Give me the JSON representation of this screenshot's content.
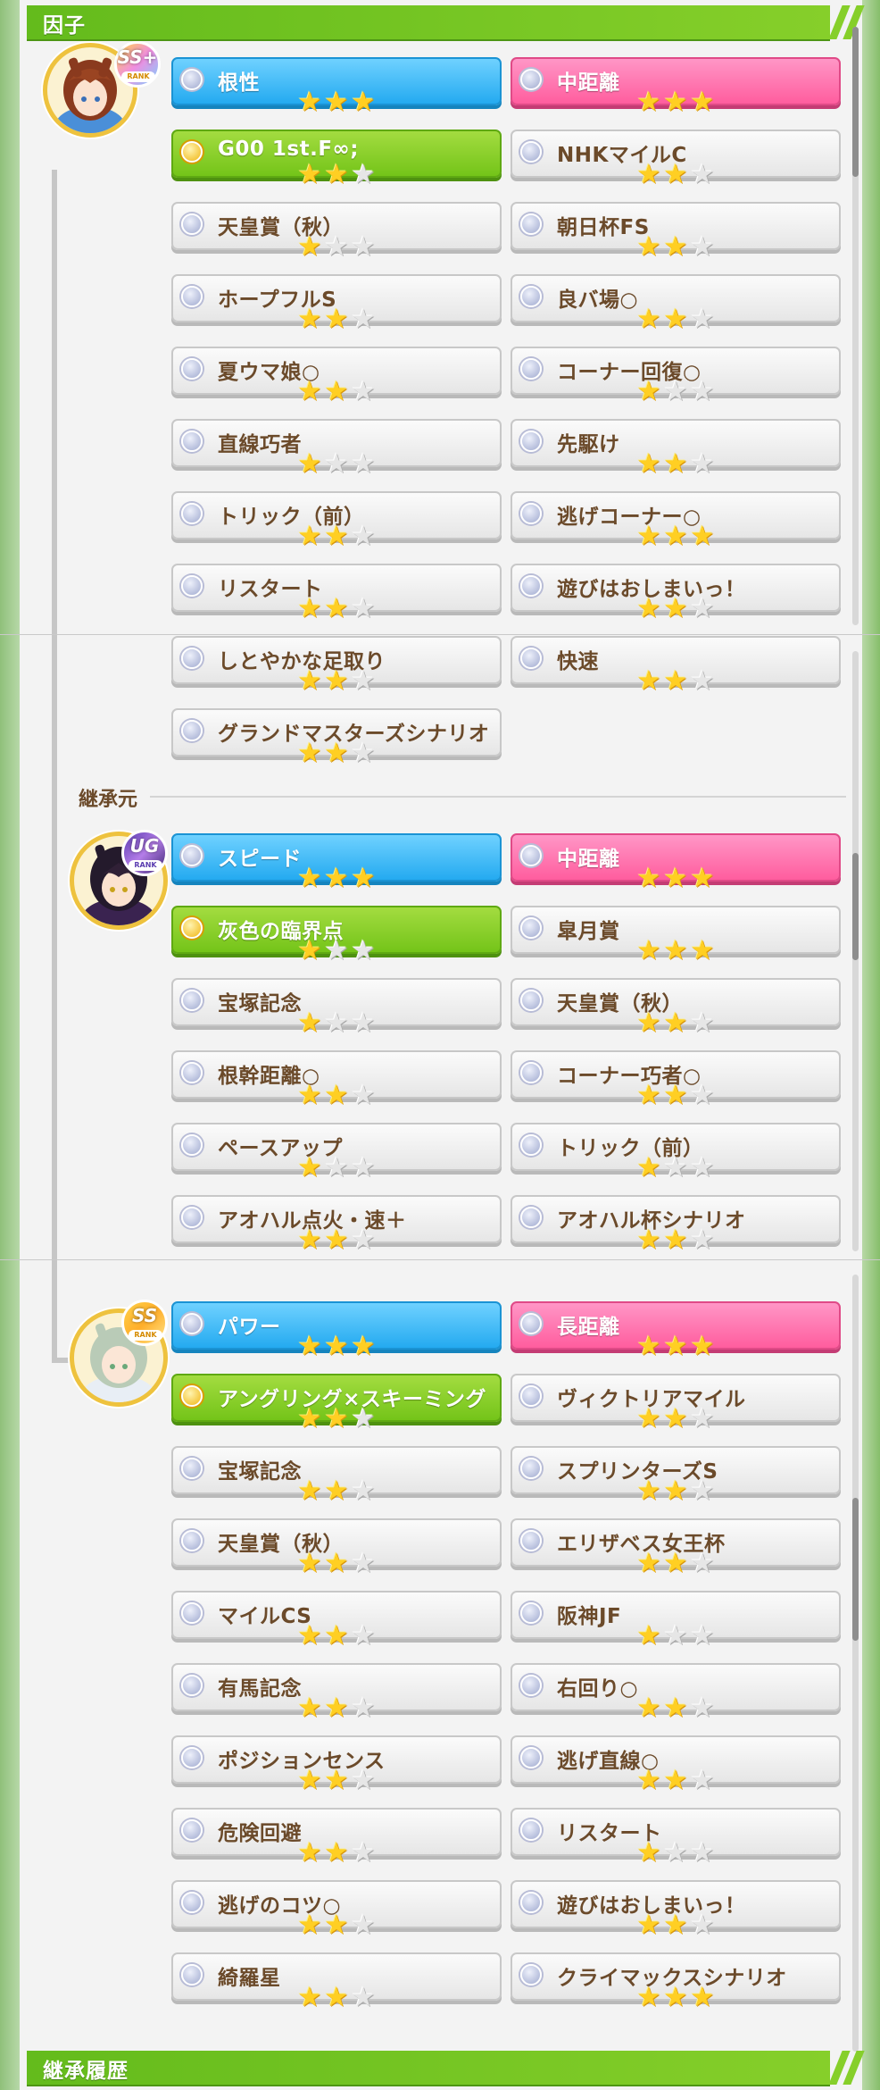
{
  "header": {
    "title": "因子"
  },
  "footer": {
    "title": "継承履歴"
  },
  "parents_label": "継承元",
  "colors": {
    "accent_green": "#74c419",
    "blue": "#24aaf0",
    "pink": "#ff5d9e",
    "text_brown": "#6b4a2a",
    "star_gold": "#ffcf23"
  },
  "trainee": {
    "rank": "SS+",
    "factors": [
      {
        "name": "根性",
        "stars": 3,
        "type": "blue"
      },
      {
        "name": "中距離",
        "stars": 3,
        "type": "pink"
      },
      {
        "name": "G00 1st.F∞;",
        "stars": 2,
        "type": "green"
      },
      {
        "name": "NHKマイルC",
        "stars": 2,
        "type": "white"
      },
      {
        "name": "天皇賞（秋）",
        "stars": 1,
        "type": "white"
      },
      {
        "name": "朝日杯FS",
        "stars": 2,
        "type": "white"
      },
      {
        "name": "ホープフルS",
        "stars": 2,
        "type": "white"
      },
      {
        "name": "良バ場○",
        "stars": 2,
        "type": "white"
      },
      {
        "name": "夏ウマ娘○",
        "stars": 2,
        "type": "white"
      },
      {
        "name": "コーナー回復○",
        "stars": 1,
        "type": "white"
      },
      {
        "name": "直線巧者",
        "stars": 1,
        "type": "white"
      },
      {
        "name": "先駆け",
        "stars": 2,
        "type": "white"
      },
      {
        "name": "トリック（前）",
        "stars": 2,
        "type": "white"
      },
      {
        "name": "逃げコーナー○",
        "stars": 3,
        "type": "white"
      },
      {
        "name": "リスタート",
        "stars": 2,
        "type": "white"
      },
      {
        "name": "遊びはおしまいっ！",
        "stars": 2,
        "type": "white"
      },
      {
        "name": "しとやかな足取り",
        "stars": 2,
        "type": "white"
      },
      {
        "name": "快速",
        "stars": 2,
        "type": "white"
      },
      {
        "name": "グランドマスターズシナリオ",
        "stars": 2,
        "type": "white"
      }
    ]
  },
  "parent1": {
    "rank": "UG",
    "factors": [
      {
        "name": "スピード",
        "stars": 3,
        "type": "blue"
      },
      {
        "name": "中距離",
        "stars": 3,
        "type": "pink"
      },
      {
        "name": "灰色の臨界点",
        "stars": 1,
        "type": "green"
      },
      {
        "name": "皐月賞",
        "stars": 3,
        "type": "white"
      },
      {
        "name": "宝塚記念",
        "stars": 1,
        "type": "white"
      },
      {
        "name": "天皇賞（秋）",
        "stars": 2,
        "type": "white"
      },
      {
        "name": "根幹距離○",
        "stars": 2,
        "type": "white"
      },
      {
        "name": "コーナー巧者○",
        "stars": 2,
        "type": "white"
      },
      {
        "name": "ペースアップ",
        "stars": 1,
        "type": "white"
      },
      {
        "name": "トリック（前）",
        "stars": 1,
        "type": "white"
      },
      {
        "name": "アオハル点火・速＋",
        "stars": 2,
        "type": "white"
      },
      {
        "name": "アオハル杯シナリオ",
        "stars": 2,
        "type": "white"
      }
    ]
  },
  "parent2": {
    "rank": "SS",
    "factors": [
      {
        "name": "パワー",
        "stars": 3,
        "type": "blue"
      },
      {
        "name": "長距離",
        "stars": 3,
        "type": "pink"
      },
      {
        "name": "アングリング×スキーミング",
        "stars": 2,
        "type": "green"
      },
      {
        "name": "ヴィクトリアマイル",
        "stars": 2,
        "type": "white"
      },
      {
        "name": "宝塚記念",
        "stars": 2,
        "type": "white"
      },
      {
        "name": "スプリンターズS",
        "stars": 2,
        "type": "white"
      },
      {
        "name": "天皇賞（秋）",
        "stars": 2,
        "type": "white"
      },
      {
        "name": "エリザベス女王杯",
        "stars": 2,
        "type": "white"
      },
      {
        "name": "マイルCS",
        "stars": 2,
        "type": "white"
      },
      {
        "name": "阪神JF",
        "stars": 1,
        "type": "white"
      },
      {
        "name": "有馬記念",
        "stars": 2,
        "type": "white"
      },
      {
        "name": "右回り○",
        "stars": 2,
        "type": "white"
      },
      {
        "name": "ポジションセンス",
        "stars": 2,
        "type": "white"
      },
      {
        "name": "逃げ直線○",
        "stars": 2,
        "type": "white"
      },
      {
        "name": "危険回避",
        "stars": 2,
        "type": "white"
      },
      {
        "name": "リスタート",
        "stars": 1,
        "type": "white"
      },
      {
        "name": "逃げのコツ○",
        "stars": 2,
        "type": "white"
      },
      {
        "name": "遊びはおしまいっ！",
        "stars": 2,
        "type": "white"
      },
      {
        "name": "綺羅星",
        "stars": 2,
        "type": "white"
      },
      {
        "name": "クライマックスシナリオ",
        "stars": 3,
        "type": "white"
      }
    ]
  }
}
